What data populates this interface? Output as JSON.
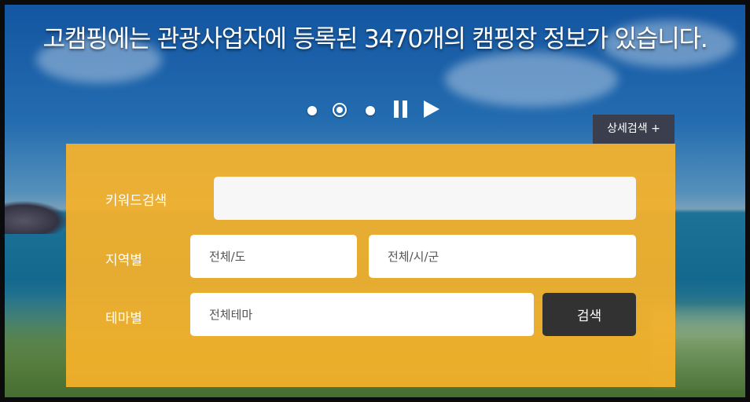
{
  "hero": {
    "headline": "고캠핑에는 관광사업자에 등록된 3470개의 캠핑장 정보가 있습니다.",
    "slide_dots": 3,
    "active_slide": 2
  },
  "advanced_search": {
    "label": "상세검색 +"
  },
  "search_form": {
    "keyword_label": "키워드검색",
    "keyword_value": "",
    "region_label": "지역별",
    "province_value": "전체/도",
    "city_value": "전체/시/군",
    "theme_label": "테마별",
    "theme_value": "전체테마",
    "search_button": "검색"
  },
  "colors": {
    "panel": "#f6b22a",
    "search_button": "#323232",
    "advanced_button": "#3b3f4d"
  },
  "icons": [
    "dot-icon",
    "pause-icon",
    "play-icon"
  ]
}
